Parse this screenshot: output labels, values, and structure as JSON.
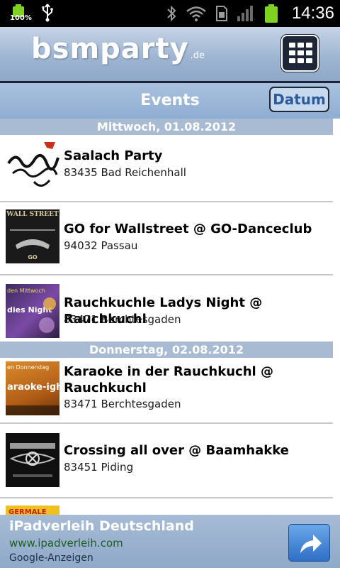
{
  "status_bar": {
    "battery_percent": "100%",
    "time": "14:36",
    "icons": [
      "battery-icon",
      "usb-icon",
      "bluetooth-icon",
      "wifi-icon",
      "sim-icon",
      "signal-icon",
      "battery-icon"
    ]
  },
  "app": {
    "logo_main": "bsmparty",
    "logo_tld": ".de",
    "menu_icon": "grid-menu-icon"
  },
  "events_header": {
    "title": "Events",
    "sort_button": "Datum"
  },
  "days": [
    {
      "date": "Mittwoch, 01.08.2012",
      "events": [
        {
          "title": "Saalach Party",
          "location": "83435 Bad Reichenhall"
        },
        {
          "title": "GO for Wallstreet @ GO-Danceclub",
          "location": "94032 Passau"
        },
        {
          "title": "Rauchkuchle Ladys Night @ Rauchkuchl",
          "location": "83471 Berchtesgaden"
        }
      ]
    },
    {
      "date": "Donnerstag, 02.08.2012",
      "events": [
        {
          "title": "Karaoke in der Rauchkuchl @ Rauchkuchl",
          "location": "83471 Berchtesgaden"
        },
        {
          "title": "Crossing all over @ Baamhakke",
          "location": "83451 Piding"
        }
      ]
    }
  ],
  "thumb_texts": {
    "wall_street": "WALL STREET",
    "mittwoch": "den Mittwoch",
    "ladies_night": "dies Night",
    "donnerstag": "en Donnerstag",
    "karaoke": "araoke-ight",
    "germale": "GERMALE"
  },
  "ad": {
    "title": "iPadverleih Deutschland",
    "url": "www.ipadverleih.com",
    "source": "Google-Anzeigen",
    "button_icon": "share-arrow-icon"
  }
}
